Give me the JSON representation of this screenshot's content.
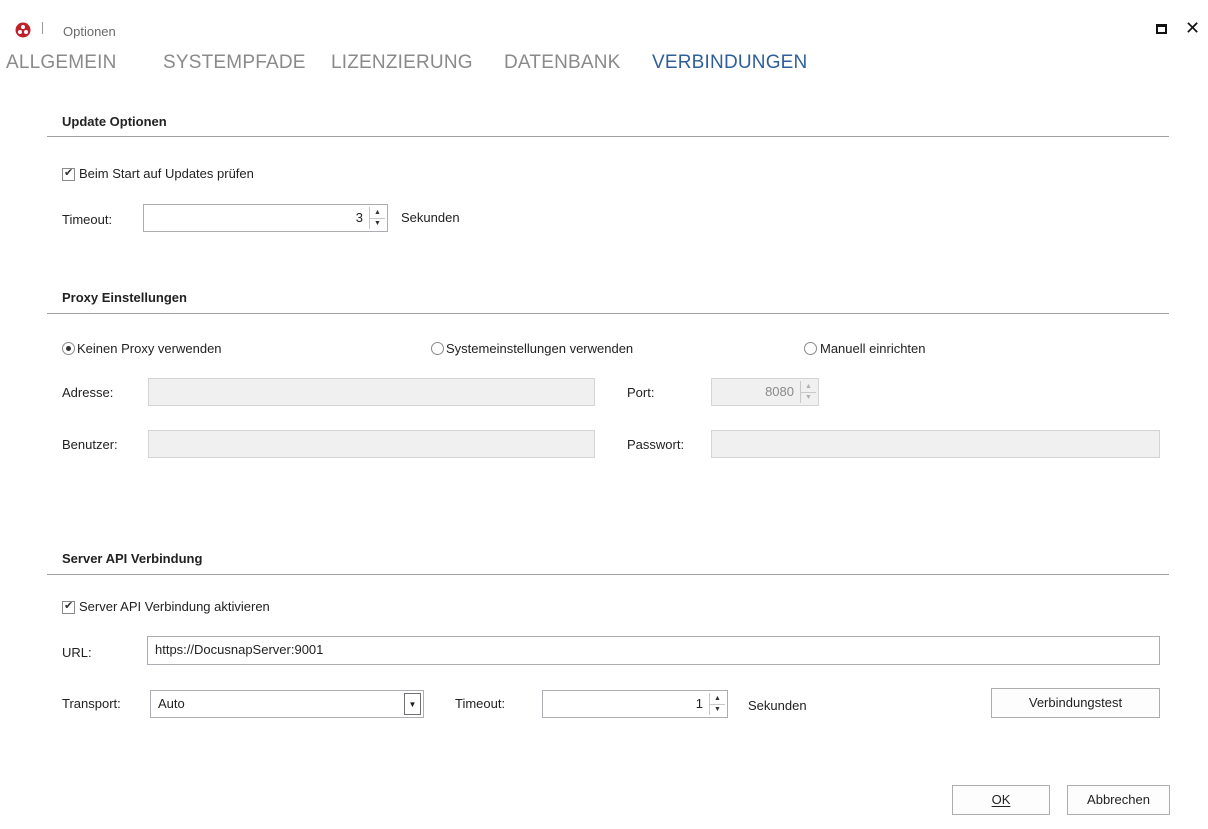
{
  "window": {
    "title": "Optionen"
  },
  "tabs": [
    "ALLGEMEIN",
    "SYSTEMPFADE",
    "LIZENZIERUNG",
    "DATENBANK",
    "VERBINDUNGEN"
  ],
  "update": {
    "title": "Update Optionen",
    "check_label": "Beim Start auf Updates prüfen",
    "checked": true,
    "timeout_label": "Timeout:",
    "timeout_value": "3",
    "unit": "Sekunden"
  },
  "proxy": {
    "title": "Proxy Einstellungen",
    "options": [
      "Keinen Proxy verwenden",
      "Systemeinstellungen verwenden",
      "Manuell einrichten"
    ],
    "selected": "Keinen Proxy verwenden",
    "address_label": "Adresse:",
    "port_label": "Port:",
    "port_value": "8080",
    "user_label": "Benutzer:",
    "password_label": "Passwort:"
  },
  "server": {
    "title": "Server API Verbindung",
    "activate_label": "Server API Verbindung aktivieren",
    "checked": true,
    "url_label": "URL:",
    "url_value": "https://DocusnapServer:9001",
    "transport_label": "Transport:",
    "transport_value": "Auto",
    "timeout_label": "Timeout:",
    "timeout_value": "1",
    "unit": "Sekunden",
    "test_button": "Verbindungstest"
  },
  "footer": {
    "ok": "OK",
    "cancel": "Abbrechen"
  },
  "icons": {
    "app": "app-logo-icon",
    "maximize": "maximize-icon",
    "close": "close-icon"
  }
}
